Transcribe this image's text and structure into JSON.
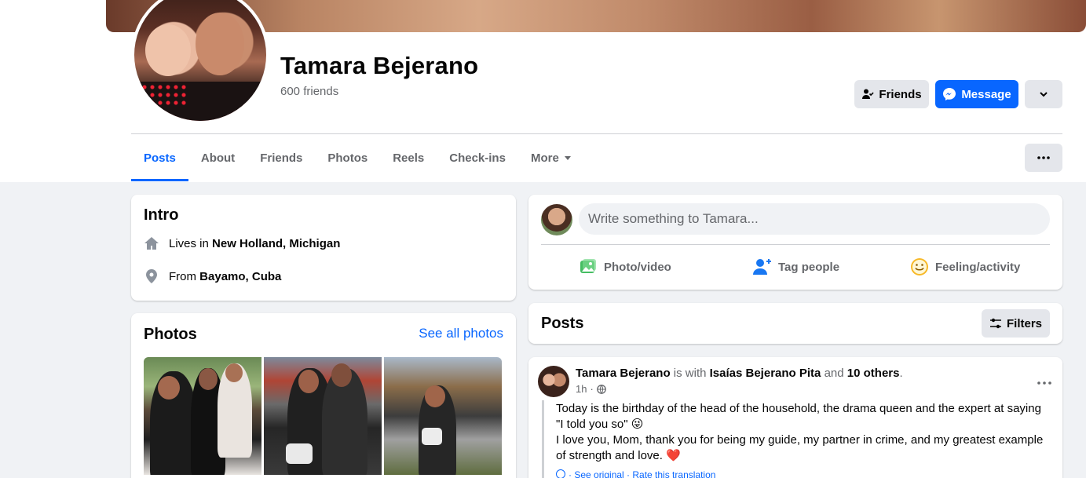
{
  "profile": {
    "name": "Tamara Bejerano",
    "friends_count": "600 friends"
  },
  "actions": {
    "friends_label": "Friends",
    "message_label": "Message"
  },
  "tabs": [
    {
      "label": "Posts",
      "active": true
    },
    {
      "label": "About"
    },
    {
      "label": "Friends"
    },
    {
      "label": "Photos"
    },
    {
      "label": "Reels"
    },
    {
      "label": "Check-ins"
    },
    {
      "label": "More"
    }
  ],
  "intro": {
    "title": "Intro",
    "lives_prefix": "Lives in",
    "lives_place": "New Holland, Michigan",
    "from_prefix": "From",
    "from_place": "Bayamo, Cuba"
  },
  "photos": {
    "title": "Photos",
    "see_all": "See all photos"
  },
  "composer": {
    "placeholder": "Write something to Tamara...",
    "photo_video": "Photo/video",
    "tag_people": "Tag people",
    "feeling_activity": "Feeling/activity"
  },
  "posts_section": {
    "title": "Posts",
    "filters_label": "Filters"
  },
  "post": {
    "author": "Tamara Bejerano",
    "is_with": "is with",
    "tagged": "Isaías Bejerano Pita",
    "and": "and",
    "others": "10 others",
    "period": ".",
    "time": "1h",
    "text_line1": "Today is the birthday of the head of the household, the drama queen and the expert at saying \"I told you so\" 😜",
    "text_line2": "I love you, Mom, thank you for being my guide, my partner in crime, and my greatest example of strength and love. ❤️",
    "see_original": "· See original · Rate this translation"
  },
  "colors": {
    "accent": "#0866ff",
    "secondary_text": "#65676b",
    "page_bg": "#f0f2f5",
    "button_gray": "#e4e6eb"
  },
  "icons": [
    "friends-check-icon",
    "messenger-icon",
    "chevron-down-icon",
    "more-dots-icon",
    "home-icon",
    "location-pin-icon",
    "photo-video-icon",
    "tag-people-icon",
    "feeling-smile-icon",
    "filters-icon",
    "globe-icon"
  ]
}
